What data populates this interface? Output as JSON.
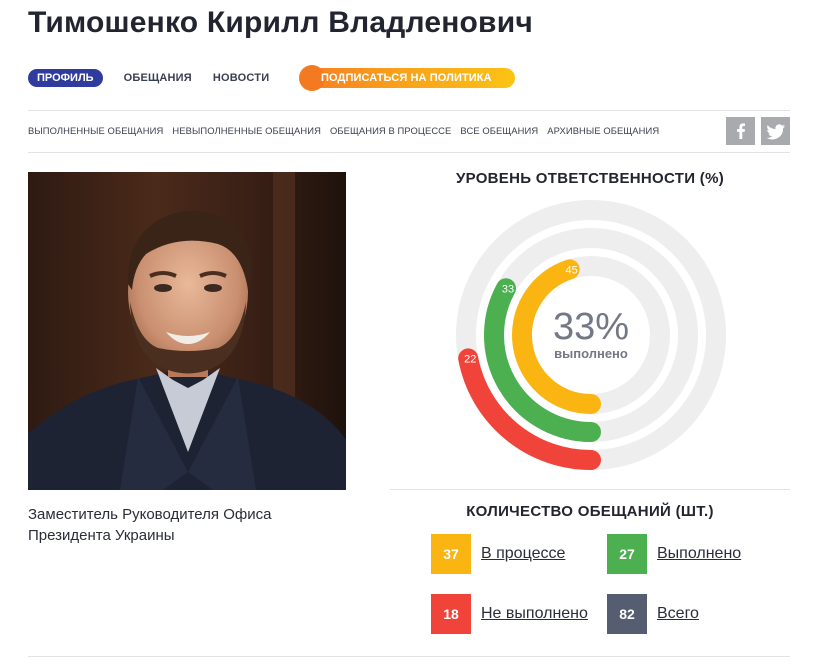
{
  "person": {
    "name": "Тимошенко Кирилл Владленович",
    "position": "Заместитель Руководителя Офиса Президента Украины"
  },
  "nav": {
    "tabs": [
      {
        "label": "ПРОФИЛЬ",
        "active": true
      },
      {
        "label": "ОБЕЩАНИЯ",
        "active": false
      },
      {
        "label": "НОВОСТИ",
        "active": false
      }
    ],
    "subscribe_label": "ПОДПИСАТЬСЯ НА ПОЛИТИКА"
  },
  "subnav": [
    "ВЫПОЛНЕННЫЕ ОБЕЩАНИЯ",
    "НЕВЫПОЛНЕННЫЕ ОБЕЩАНИЯ",
    "ОБЕЩАНИЯ В ПРОЦЕССЕ",
    "ВСЕ ОБЕЩАНИЯ",
    "АРХИВНЫЕ ОБЕЩАНИЯ"
  ],
  "social": {
    "facebook_icon": "f",
    "twitter_icon": "twitter-bird"
  },
  "responsibility": {
    "title": "УРОВЕНЬ ОТВЕТСТВЕННОСТИ (%)",
    "center_value": "33%",
    "center_label": "выполнено",
    "rings": [
      {
        "name": "red",
        "value": 22,
        "color": "#f0433a"
      },
      {
        "name": "green",
        "value": 33,
        "color": "#4caf50"
      },
      {
        "name": "yellow",
        "value": 45,
        "color": "#fbb513"
      }
    ],
    "track_color": "#eeeeef"
  },
  "counts": {
    "title": "КОЛИЧЕСТВО ОБЕЩАНИЙ (ШТ.)",
    "items": [
      {
        "value": "37",
        "label": "В процессе",
        "color": "#fbb513"
      },
      {
        "value": "27",
        "label": "Выполнено",
        "color": "#4caf50"
      },
      {
        "value": "18",
        "label": "Не выполнено",
        "color": "#f0433a"
      },
      {
        "value": "82",
        "label": "Всего",
        "color": "#545e70"
      }
    ]
  }
}
